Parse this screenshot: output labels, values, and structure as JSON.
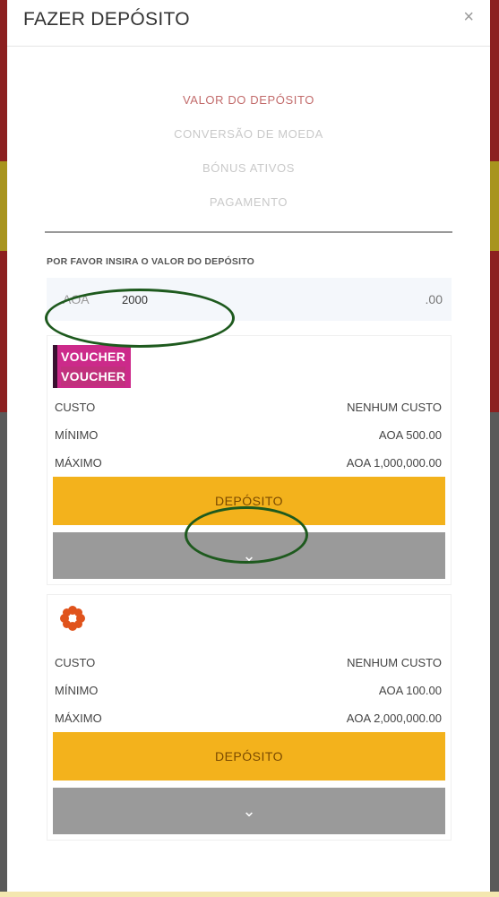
{
  "modal": {
    "title": "FAZER DEPÓSITO",
    "close_label": "×"
  },
  "steps": [
    {
      "label": "VALOR DO DEPÓSITO",
      "active": true
    },
    {
      "label": "CONVERSÃO DE MOEDA",
      "active": false
    },
    {
      "label": "BÓNUS ATIVOS",
      "active": false
    },
    {
      "label": "PAGAMENTO",
      "active": false
    }
  ],
  "amount": {
    "label": "POR FAVOR INSIRA O VALOR DO DEPÓSITO",
    "currency": "AOA",
    "value": "2000",
    "decimals": ".00"
  },
  "methods": [
    {
      "logo_lines": [
        "VOUCHER",
        "VOUCHER"
      ],
      "cost_label": "CUSTO",
      "cost_value": "NENHUM CUSTO",
      "min_label": "MÍNIMO",
      "min_value": "AOA 500.00",
      "max_label": "MÁXIMO",
      "max_value": "AOA 1,000,000.00",
      "deposit_label": "DEPÓSITO",
      "expand_icon": "⌄"
    },
    {
      "logo_icon": "flower-logo-icon",
      "cost_label": "CUSTO",
      "cost_value": "NENHUM CUSTO",
      "min_label": "MÍNIMO",
      "min_value": "AOA 100.00",
      "max_label": "MÁXIMO",
      "max_value": "AOA 2,000,000.00",
      "deposit_label": "DEPÓSITO",
      "expand_icon": "⌄"
    }
  ],
  "colors": {
    "deposit_button": "#f3b21c",
    "expand_button": "#9a9a9a",
    "active_step": "#c26b6b",
    "annotation_ellipse": "#1e5a1e"
  }
}
